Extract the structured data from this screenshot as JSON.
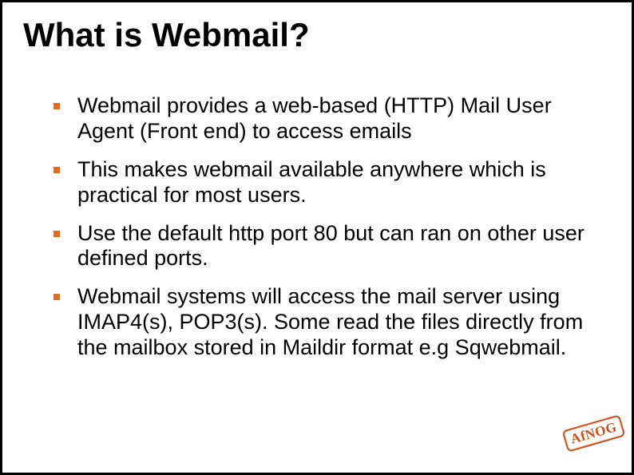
{
  "title": "What is Webmail?",
  "bullets": [
    "Webmail provides a web-based (HTTP) Mail User Agent (Front end) to access emails",
    "This makes webmail available anywhere which is practical for most users.",
    "Use the default http port 80 but can ran on other user defined ports.",
    " Webmail systems will access the mail server using IMAP4(s), POP3(s). Some read the files directly from the mailbox stored in Maildir format e.g Sqwebmail."
  ],
  "logo_text": "AfNOG",
  "bullet_color": "#e56b1f",
  "logo_color": "#c94f1c"
}
